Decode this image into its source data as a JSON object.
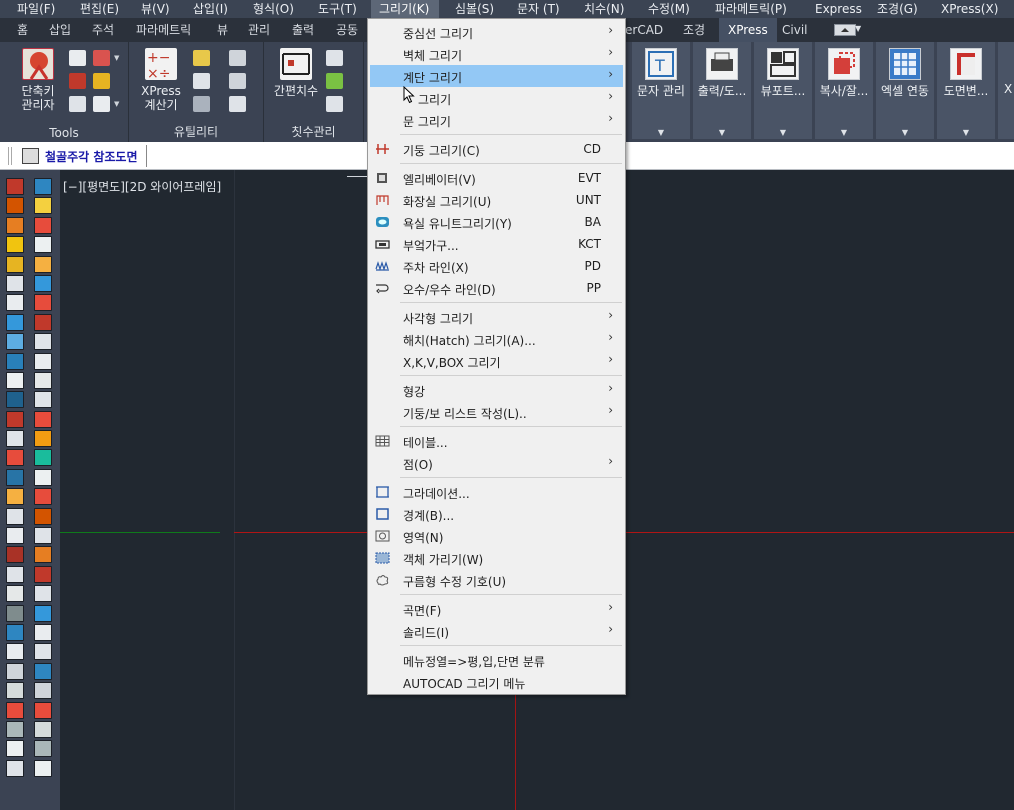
{
  "menubar": {
    "items": [
      {
        "label": "파일(F)"
      },
      {
        "label": "편집(E)"
      },
      {
        "label": "뷰(V)"
      },
      {
        "label": "삽입(I)"
      },
      {
        "label": "형식(O)"
      },
      {
        "label": "도구(T)"
      },
      {
        "label": "그리기(K)"
      },
      {
        "label": "심볼(S)"
      },
      {
        "label": "문자 (T)"
      },
      {
        "label": "치수(N)"
      },
      {
        "label": "수정(M)"
      },
      {
        "label": "파라메트릭(P)"
      },
      {
        "label": "Express"
      },
      {
        "label": "조경(G)"
      },
      {
        "label": "XPress(X)"
      }
    ]
  },
  "ribbon_tabs": {
    "items": [
      {
        "label": "홈"
      },
      {
        "label": "삽입"
      },
      {
        "label": "주석"
      },
      {
        "label": "파라메트릭"
      },
      {
        "label": "뷰"
      },
      {
        "label": "관리"
      },
      {
        "label": "출력"
      },
      {
        "label": "공동 "
      },
      {
        "label": "erCAD"
      },
      {
        "label": "조경"
      },
      {
        "label": "XPress"
      },
      {
        "label": "Civil"
      }
    ]
  },
  "ribbon": {
    "tools_panel": {
      "title": "Tools",
      "shortcut_label": "단축키\n관리자"
    },
    "utility_panel": {
      "title": "유틸리티",
      "xpress_calc_label": "XPress\n계산기"
    },
    "dim_panel": {
      "title": "칫수관리",
      "simple_dim_label": "간편치수"
    },
    "xp_buttons": [
      {
        "label": "문자 관리"
      },
      {
        "label": "출력/도..."
      },
      {
        "label": "뷰포트..."
      },
      {
        "label": "복사/잘..."
      },
      {
        "label": "엑셀 연동"
      },
      {
        "label": "도면변..."
      },
      {
        "label": "X"
      }
    ]
  },
  "filetab": {
    "label": "철골주각 참조도면"
  },
  "canvas": {
    "view_label": "[−][평면도][2D 와이어프레임]"
  },
  "menu": {
    "items": [
      {
        "label": "중심선 그리기",
        "shortcut": "",
        "has_sub": true
      },
      {
        "label": "벽체 그리기",
        "shortcut": "",
        "has_sub": true
      },
      {
        "label": "계단 그리기",
        "shortcut": "",
        "has_sub": true
      },
      {
        "label": "그리기",
        "shortcut": "",
        "has_sub": true
      },
      {
        "label": "문 그리기",
        "shortcut": "",
        "has_sub": true
      },
      {
        "label": "기둥 그리기(C)",
        "shortcut": "CD",
        "has_sub": false
      },
      {
        "label": "엘리베이터(V)",
        "shortcut": "EVT",
        "has_sub": false
      },
      {
        "label": "화장실 그리기(U)",
        "shortcut": "UNT",
        "has_sub": false
      },
      {
        "label": "욕실 유니트그리기(Y)",
        "shortcut": "BA",
        "has_sub": false
      },
      {
        "label": "부엌가구...",
        "shortcut": "KCT",
        "has_sub": false
      },
      {
        "label": "주차 라인(X)",
        "shortcut": "PD",
        "has_sub": false
      },
      {
        "label": "오수/우수 라인(D)",
        "shortcut": "PP",
        "has_sub": false
      },
      {
        "label": "사각형 그리기",
        "shortcut": "",
        "has_sub": true
      },
      {
        "label": "해치(Hatch) 그리기(A)...",
        "shortcut": "",
        "has_sub": true
      },
      {
        "label": "X,K,V,BOX 그리기",
        "shortcut": "",
        "has_sub": true
      },
      {
        "label": "형강",
        "shortcut": "",
        "has_sub": true
      },
      {
        "label": "기둥/보 리스트 작성(L)..",
        "shortcut": "",
        "has_sub": true
      },
      {
        "label": "테이블...",
        "shortcut": "",
        "has_sub": false
      },
      {
        "label": "점(O)",
        "shortcut": "",
        "has_sub": true
      },
      {
        "label": "그라데이션...",
        "shortcut": "",
        "has_sub": false
      },
      {
        "label": "경계(B)...",
        "shortcut": "",
        "has_sub": false
      },
      {
        "label": "영역(N)",
        "shortcut": "",
        "has_sub": false
      },
      {
        "label": "객체 가리기(W)",
        "shortcut": "",
        "has_sub": false
      },
      {
        "label": "구름형 수정 기호(U)",
        "shortcut": "",
        "has_sub": false
      },
      {
        "label": "곡면(F)",
        "shortcut": "",
        "has_sub": true
      },
      {
        "label": "솔리드(I)",
        "shortcut": "",
        "has_sub": true
      },
      {
        "label": "메뉴정열=>평,입,단면 분류",
        "shortcut": "",
        "has_sub": false
      },
      {
        "label": "AUTOCAD 그리기 메뉴",
        "shortcut": "",
        "has_sub": false
      }
    ],
    "submenu_arrow": "›"
  },
  "colors": {
    "background": "#212830",
    "menu_highlight": "#93c8f5",
    "ribbon": "#3b4353",
    "axis_x": "#b01515",
    "axis_y": "#0f7a1b",
    "active_tab": "#455063"
  }
}
